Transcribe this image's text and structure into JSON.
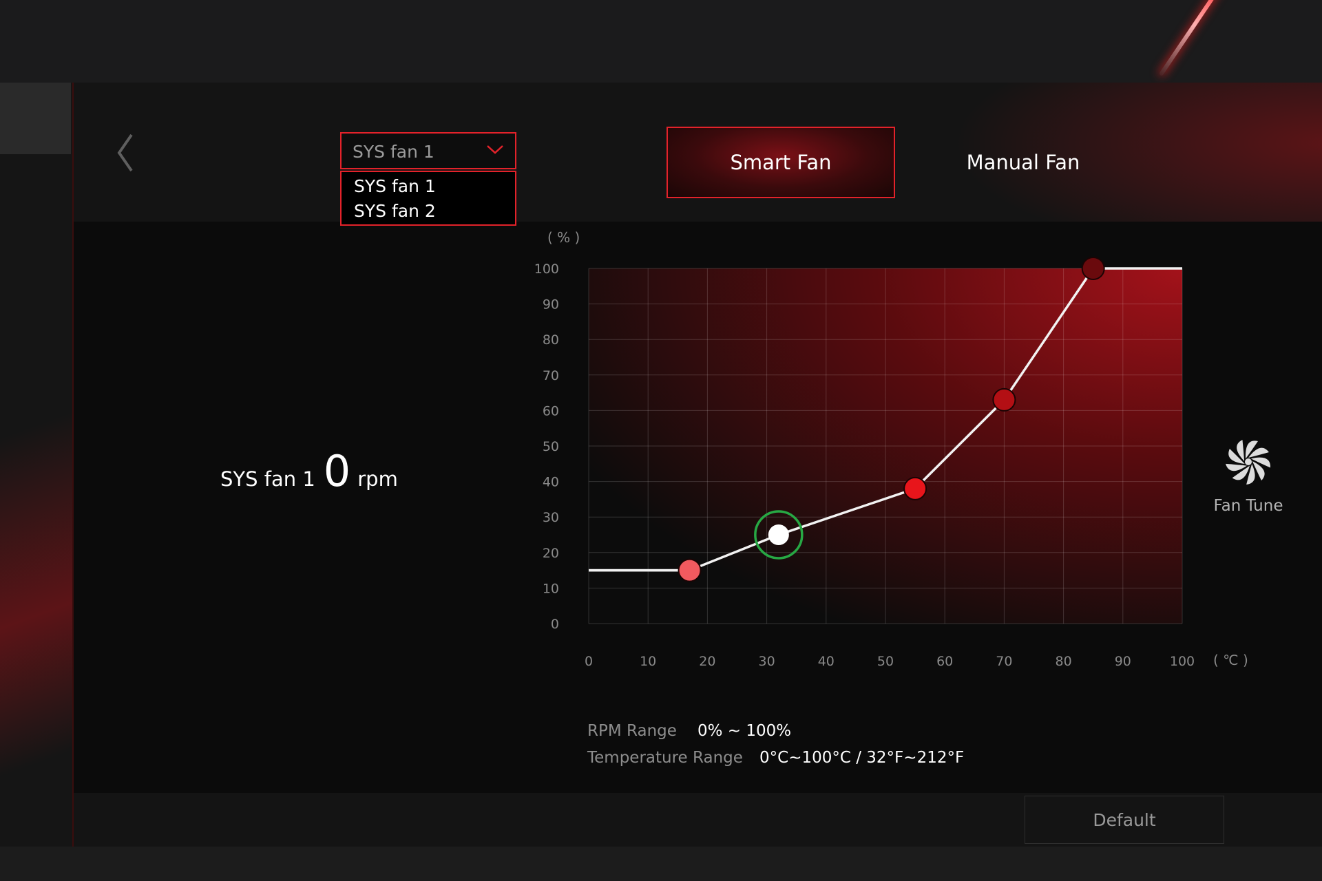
{
  "app": {
    "back_icon": "chevron-left-icon"
  },
  "fan_select": {
    "selected": "SYS fan 1",
    "options": [
      "SYS fan 1",
      "SYS fan 2"
    ]
  },
  "mode_tabs": [
    {
      "label": "Smart Fan",
      "active": true
    },
    {
      "label": "Manual Fan",
      "active": false
    }
  ],
  "readout": {
    "label": "SYS fan 1",
    "value": "0",
    "unit": "rpm"
  },
  "chart_data": {
    "type": "line",
    "y_unit_label": "( % )",
    "x_unit_label": "( ℃ )",
    "xlim": [
      0,
      100
    ],
    "ylim": [
      0,
      100
    ],
    "x_ticks": [
      0,
      10,
      20,
      30,
      40,
      50,
      60,
      70,
      80,
      90,
      100
    ],
    "y_ticks": [
      0,
      10,
      20,
      30,
      40,
      50,
      60,
      70,
      80,
      90,
      100
    ],
    "grid": true,
    "curve_start": {
      "x": 0,
      "y": 15
    },
    "curve_end": {
      "x": 100,
      "y": 100
    },
    "points": [
      {
        "x": 17,
        "y": 15,
        "color": "#f25a5f"
      },
      {
        "x": 32,
        "y": 25,
        "color": "#ffffff",
        "selected": true
      },
      {
        "x": 55,
        "y": 38,
        "color": "#e8151b"
      },
      {
        "x": 70,
        "y": 63,
        "color": "#b30f14"
      },
      {
        "x": 85,
        "y": 100,
        "color": "#6a0a0d"
      }
    ]
  },
  "ranges": {
    "rpm_label": "RPM Range",
    "rpm_value": "0% ~ 100%",
    "temp_label": "Temperature Range",
    "temp_value": "0°C~100°C / 32°F~212°F"
  },
  "fan_tune": {
    "label": "Fan Tune",
    "icon": "fan-icon"
  },
  "default_button": {
    "label": "Default"
  },
  "colors": {
    "accent": "#e3222a",
    "background": "#0b0b0b",
    "curve": "#f2f2f2",
    "selected_ring": "#27a844"
  }
}
